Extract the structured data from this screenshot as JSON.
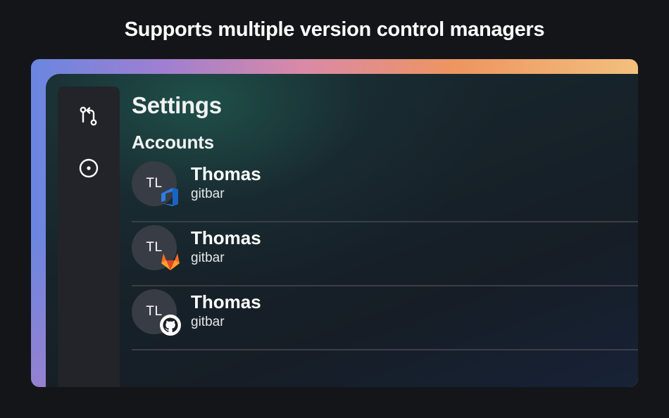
{
  "headline": "Supports multiple version control managers",
  "sidebar": {
    "items": [
      {
        "icon": "git-pull-request-icon"
      },
      {
        "icon": "circle-dot-icon"
      }
    ]
  },
  "settings": {
    "title": "Settings",
    "section": "Accounts",
    "accounts": [
      {
        "initials": "TL",
        "name": "Thomas",
        "sub": "gitbar",
        "provider": "azure-devops",
        "provider_color": "#2b7de9"
      },
      {
        "initials": "TL",
        "name": "Thomas",
        "sub": "gitbar",
        "provider": "gitlab",
        "provider_color": "#fc6d26"
      },
      {
        "initials": "TL",
        "name": "Thomas",
        "sub": "gitbar",
        "provider": "github",
        "provider_color": "#ffffff"
      }
    ]
  },
  "colors": {
    "background": "#141518",
    "sidebar": "#222429",
    "avatar": "#383c44",
    "divider": "#3a3f47"
  }
}
